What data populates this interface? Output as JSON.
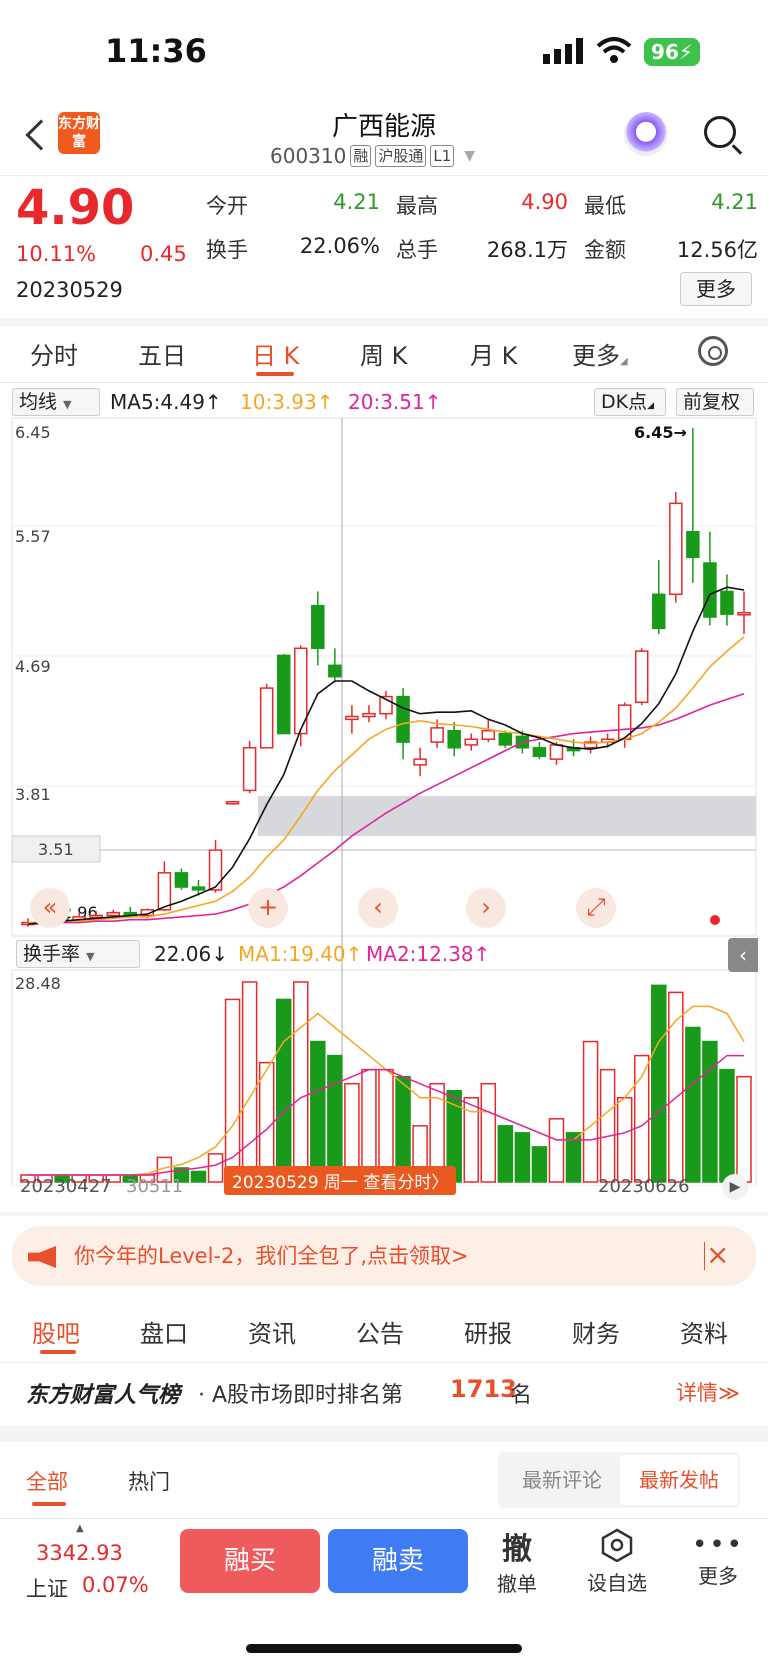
{
  "status": {
    "time": "11:36",
    "battery": "96"
  },
  "header": {
    "logo": "东方财富",
    "title": "广西能源",
    "code": "600310",
    "tags": [
      "融",
      "沪股通",
      "L1"
    ]
  },
  "quote": {
    "price": "4.90",
    "pct": "10.11%",
    "change": "0.45",
    "date": "20230529",
    "fields": [
      {
        "label": "今开",
        "value": "4.21",
        "color": "green"
      },
      {
        "label": "最高",
        "value": "4.90",
        "color": "red"
      },
      {
        "label": "最低",
        "value": "4.21",
        "color": "green"
      },
      {
        "label": "换手",
        "value": "22.06%",
        "color": "black"
      },
      {
        "label": "总手",
        "value": "268.1万",
        "color": "black"
      },
      {
        "label": "金额",
        "value": "12.56亿",
        "color": "black"
      }
    ],
    "more": "更多"
  },
  "tabs": [
    "分时",
    "五日",
    "日 K",
    "周 K",
    "月 K",
    "更多"
  ],
  "ma_row": {
    "dropdown": "均线",
    "ma5": "MA5:4.49↑",
    "ma10": "10:3.93↑",
    "ma20": "20:3.51↑",
    "dk": "DK点",
    "adjust": "前复权"
  },
  "chart_axes": {
    "y_labels": [
      "6.45",
      "5.57",
      "4.69",
      "3.81"
    ],
    "current_line": "3.51",
    "low_label": "2.96",
    "high_label": "6.45→"
  },
  "vol_row": {
    "dropdown": "换手率",
    "value": "22.06↓",
    "ma1": "MA1:19.40↑",
    "ma2": "MA2:12.38↑",
    "max_label": "28.48"
  },
  "date_axis": {
    "left": "20230427",
    "mid": "30511",
    "right": "20230626",
    "callout": "20230529 周一 查看分时〉"
  },
  "colors": {
    "up": "#e8282b",
    "down": "#1a9a1a",
    "ma5": "#111111",
    "ma10": "#f5a623",
    "ma20": "#e0249a",
    "accent": "#e8502b"
  },
  "chart_data": {
    "type": "candlestick",
    "ohlc": [
      [
        2.97,
        3.0,
        2.94,
        2.97
      ],
      [
        2.97,
        3.02,
        2.95,
        3.0
      ],
      [
        3.0,
        3.03,
        2.97,
        2.98
      ],
      [
        2.98,
        3.04,
        2.97,
        3.01
      ],
      [
        3.01,
        3.05,
        2.99,
        3.02
      ],
      [
        3.02,
        3.06,
        3.0,
        3.04
      ],
      [
        3.04,
        3.08,
        3.01,
        3.02
      ],
      [
        3.02,
        3.07,
        3.0,
        3.06
      ],
      [
        3.06,
        3.4,
        3.05,
        3.32
      ],
      [
        3.32,
        3.35,
        3.2,
        3.22
      ],
      [
        3.22,
        3.27,
        3.16,
        3.2
      ],
      [
        3.2,
        3.55,
        3.18,
        3.48
      ],
      [
        3.82,
        3.82,
        3.8,
        3.82
      ],
      [
        3.9,
        4.25,
        3.88,
        4.2
      ],
      [
        4.2,
        4.65,
        4.2,
        4.62
      ],
      [
        4.85,
        4.86,
        4.3,
        4.3
      ],
      [
        4.3,
        4.92,
        4.21,
        4.9
      ],
      [
        5.2,
        5.3,
        4.78,
        4.9
      ],
      [
        4.78,
        4.9,
        4.66,
        4.7
      ],
      [
        4.4,
        4.5,
        4.3,
        4.42
      ],
      [
        4.42,
        4.5,
        4.38,
        4.44
      ],
      [
        4.44,
        4.6,
        4.4,
        4.56
      ],
      [
        4.56,
        4.62,
        4.12,
        4.24
      ],
      [
        4.08,
        4.2,
        4.0,
        4.12
      ],
      [
        4.24,
        4.4,
        4.2,
        4.34
      ],
      [
        4.32,
        4.38,
        4.14,
        4.2
      ],
      [
        4.22,
        4.3,
        4.18,
        4.26
      ],
      [
        4.26,
        4.4,
        4.24,
        4.32
      ],
      [
        4.3,
        4.32,
        4.2,
        4.22
      ],
      [
        4.28,
        4.32,
        4.16,
        4.2
      ],
      [
        4.2,
        4.24,
        4.12,
        4.14
      ],
      [
        4.12,
        4.24,
        4.08,
        4.22
      ],
      [
        4.2,
        4.26,
        4.14,
        4.18
      ],
      [
        4.2,
        4.28,
        4.16,
        4.24
      ],
      [
        4.24,
        4.3,
        4.2,
        4.26
      ],
      [
        4.26,
        4.52,
        4.2,
        4.5
      ],
      [
        4.52,
        4.9,
        4.5,
        4.88
      ],
      [
        5.28,
        5.52,
        5.0,
        5.04
      ],
      [
        5.28,
        6.0,
        5.22,
        5.92
      ],
      [
        5.72,
        6.45,
        5.36,
        5.54
      ],
      [
        5.5,
        5.72,
        5.06,
        5.12
      ],
      [
        5.3,
        5.42,
        5.06,
        5.14
      ],
      [
        5.14,
        5.3,
        5.0,
        5.15
      ]
    ],
    "ma5": [
      2.96,
      2.97,
      2.98,
      2.99,
      3.0,
      3.01,
      3.02,
      3.03,
      3.08,
      3.12,
      3.17,
      3.22,
      3.36,
      3.56,
      3.8,
      4.01,
      4.33,
      4.58,
      4.67,
      4.67,
      4.6,
      4.54,
      4.48,
      4.44,
      4.45,
      4.45,
      4.46,
      4.4,
      4.36,
      4.3,
      4.27,
      4.22,
      4.2,
      4.19,
      4.21,
      4.27,
      4.37,
      4.51,
      4.72,
      5.02,
      5.28,
      5.33,
      5.31
    ],
    "ma10": [
      2.97,
      2.97,
      2.98,
      2.98,
      2.99,
      3.0,
      3.01,
      3.01,
      3.03,
      3.06,
      3.09,
      3.12,
      3.19,
      3.29,
      3.43,
      3.55,
      3.72,
      3.9,
      4.04,
      4.15,
      4.26,
      4.33,
      4.37,
      4.39,
      4.37,
      4.36,
      4.35,
      4.33,
      4.31,
      4.3,
      4.28,
      4.26,
      4.24,
      4.23,
      4.24,
      4.26,
      4.3,
      4.38,
      4.48,
      4.62,
      4.77,
      4.88,
      4.98
    ],
    "ma20": [
      2.96,
      2.96,
      2.97,
      2.97,
      2.98,
      2.98,
      2.99,
      2.99,
      3.0,
      3.01,
      3.02,
      3.03,
      3.06,
      3.1,
      3.16,
      3.22,
      3.3,
      3.39,
      3.48,
      3.58,
      3.66,
      3.74,
      3.81,
      3.88,
      3.94,
      4.0,
      4.06,
      4.12,
      4.18,
      4.24,
      4.26,
      4.28,
      4.3,
      4.31,
      4.32,
      4.33,
      4.34,
      4.36,
      4.4,
      4.45,
      4.5,
      4.54,
      4.58
    ],
    "turnover": [
      1,
      1,
      1,
      1,
      1,
      1,
      1,
      1,
      3.5,
      2,
      1.5,
      4,
      26,
      28.48,
      17,
      26,
      28.48,
      20,
      18,
      14,
      16,
      16,
      15,
      8,
      14,
      13,
      12,
      14,
      8,
      7,
      5,
      9,
      7,
      20,
      16,
      12,
      18,
      28,
      27,
      22,
      20,
      16,
      15
    ],
    "turnover_ma1": [
      1,
      1,
      1,
      1,
      1,
      1,
      1,
      1.2,
      2,
      2.5,
      3.5,
      5,
      8,
      12,
      16,
      20,
      22,
      24,
      22,
      20,
      18,
      16,
      14,
      12,
      12,
      11,
      10,
      10,
      9,
      8,
      7,
      6,
      6,
      8,
      10,
      12,
      15,
      20,
      23,
      25,
      25,
      24,
      20
    ],
    "turnover_ma2": [
      1,
      1,
      1,
      1,
      1,
      1,
      1,
      1,
      1.4,
      1.7,
      2,
      2.4,
      3.5,
      5.5,
      7.5,
      10,
      12,
      13,
      14,
      15,
      16,
      16,
      15,
      14,
      13,
      12,
      11,
      10,
      9,
      8,
      7,
      6,
      6,
      6,
      6.5,
      7,
      8,
      10,
      12,
      14,
      16,
      18,
      18
    ],
    "y_range": [
      2.96,
      6.45
    ],
    "turnover_range": [
      0,
      28.48
    ]
  },
  "banner": {
    "text": "你今年的Level-2，我们全包了,点击领取>",
    "close": "×"
  },
  "subtabs": [
    "股吧",
    "盘口",
    "资讯",
    "公告",
    "研报",
    "财务",
    "资料"
  ],
  "rank": {
    "brand": "东方财富人气榜",
    "text": "· A股市场即时排名第",
    "num": "1713",
    "unit": "名",
    "link": "详情≫"
  },
  "feed": {
    "all": "全部",
    "hot": "热门",
    "latest_comment": "最新评论",
    "latest_post": "最新发帖"
  },
  "bottom": {
    "index_value": "3342.93",
    "index_name": "上证",
    "index_pct": "0.07%",
    "buy": "融买",
    "sell": "融卖",
    "cancel_big": "撤",
    "cancel": "撤单",
    "watch": "设自选",
    "more": "更多"
  }
}
